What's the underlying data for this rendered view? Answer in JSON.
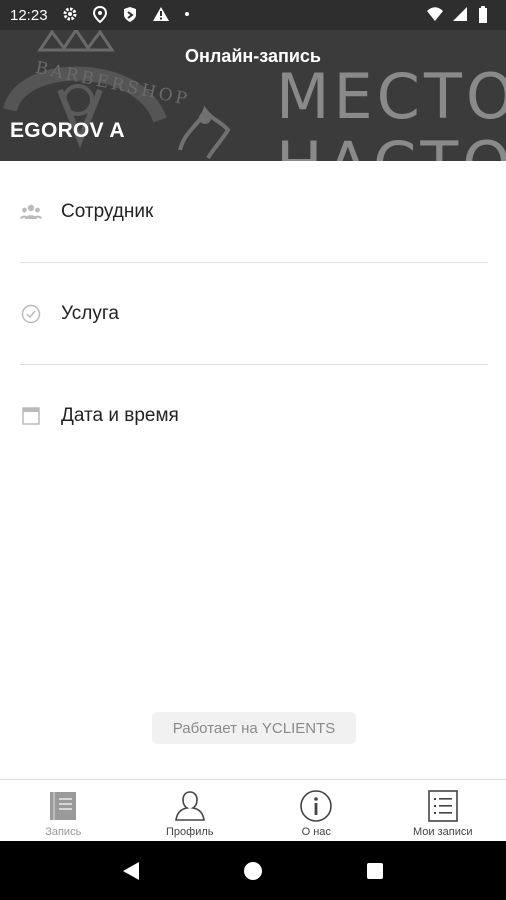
{
  "status_bar": {
    "time": "12:23",
    "icons_left": [
      "settings-icon",
      "location-pin-icon",
      "shield-icon",
      "warning-icon",
      "dot-icon"
    ],
    "icons_right": [
      "wifi-icon",
      "signal-icon",
      "battery-icon"
    ]
  },
  "header": {
    "title": "Онлайн-запись",
    "company": "EGOROV A",
    "banner_slogan_line1": "МЕСТО Д",
    "banner_slogan_line2": "НАСТОЯЩ",
    "banner_logo_text": "BARBERSHOP"
  },
  "menu": {
    "items": [
      {
        "label": "Сотрудник",
        "icon": "staff-icon"
      },
      {
        "label": "Услуга",
        "icon": "check-circle-icon"
      },
      {
        "label": "Дата и время",
        "icon": "calendar-icon"
      }
    ]
  },
  "powered_by": "Работает на YCLIENTS",
  "bottom_nav": {
    "items": [
      {
        "label": "Запись",
        "icon": "booking-icon",
        "active": true
      },
      {
        "label": "Профиль",
        "icon": "profile-icon",
        "active": false
      },
      {
        "label": "О нас",
        "icon": "info-icon",
        "active": false
      },
      {
        "label": "Мои записи",
        "icon": "list-icon",
        "active": false
      }
    ]
  },
  "system_nav": [
    "back-icon",
    "home-icon",
    "recents-icon"
  ],
  "colors": {
    "status_bar_bg": "#2e2e2e",
    "header_bg": "#3b3b3b",
    "divider": "#e0e0e0",
    "muted_text": "#8a8a8a"
  }
}
